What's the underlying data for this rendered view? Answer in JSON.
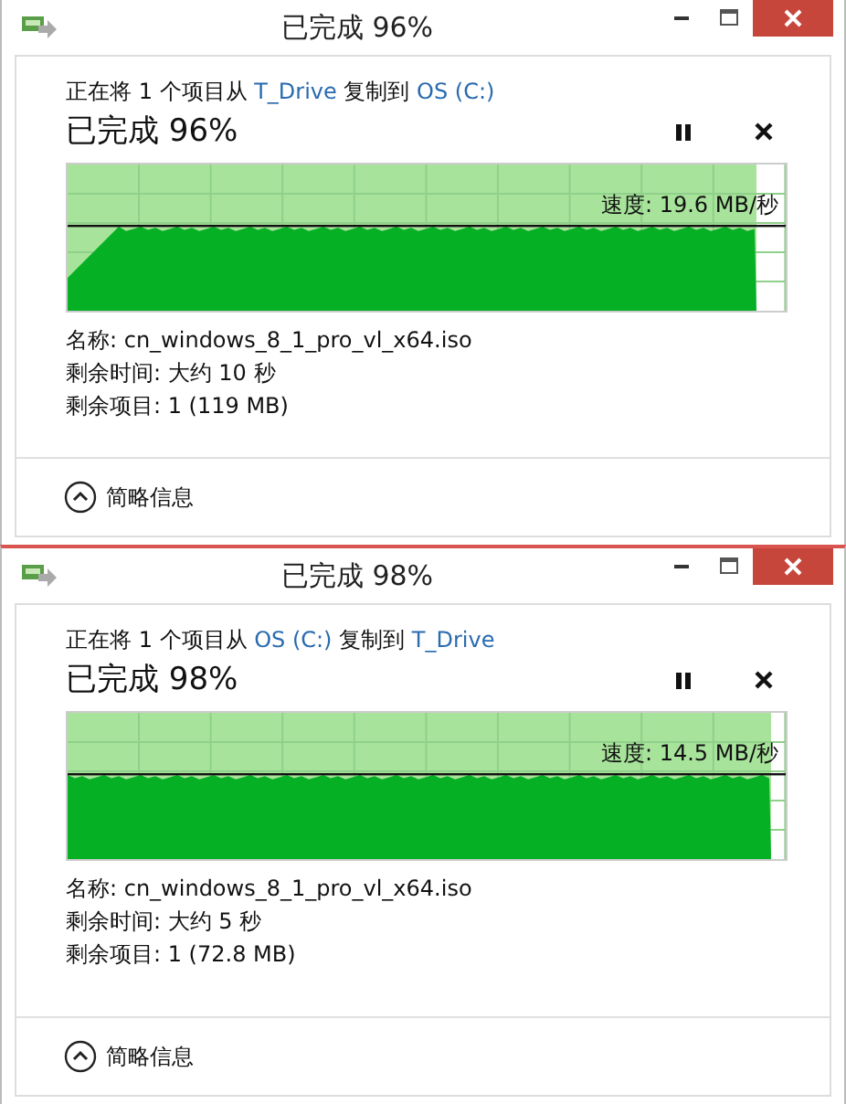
{
  "dialogs": [
    {
      "window": {
        "title": "已完成 96%"
      },
      "copy_line": {
        "prefix": "正在将 1 个项目从",
        "source": "T_Drive",
        "middle": "复制到",
        "destination": "OS (C:)"
      },
      "heading": "已完成 96%",
      "progress": {
        "level": 0.96,
        "speed": "速度: 19.6 MB/秒"
      },
      "details": [
        "名称: cn_windows_8_1_pro_vl_x64.iso",
        "剩余时间: 大约 10 秒",
        "剩余项目: 1 (119 MB)"
      ],
      "footer": {
        "label": "简略信息",
        "expanded": true
      }
    },
    {
      "window": {
        "title": "已完成 98%"
      },
      "copy_line": {
        "prefix": "正在将 1 个项目从",
        "source": "OS (C:)",
        "middle": "复制到",
        "destination": "T_Drive"
      },
      "heading": "已完成 98%",
      "progress": {
        "level": 0.98,
        "speed": "速度: 14.5 MB/秒"
      },
      "details": [
        "名称: cn_windows_8_1_pro_vl_x64.iso",
        "剩余时间: 大约 5 秒",
        "剩余项目: 1 (72.8 MB)"
      ],
      "footer": {
        "label": "简略信息",
        "expanded": true
      }
    }
  ]
}
